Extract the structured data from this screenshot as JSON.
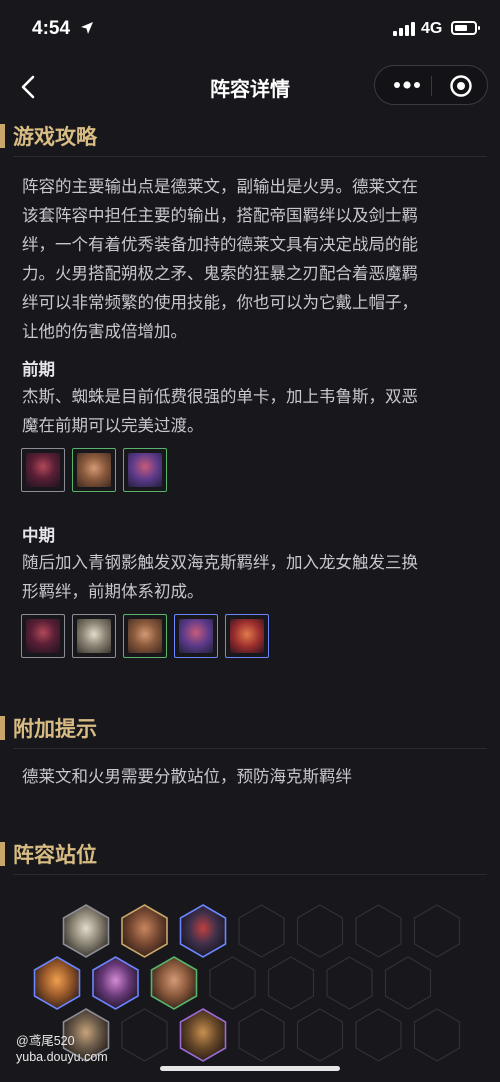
{
  "status": {
    "time": "4:54",
    "network": "4G"
  },
  "nav": {
    "title": "阵容详情"
  },
  "strategy": {
    "heading": "游戏攻略",
    "lines": [
      "阵容的主要输出点是德莱文，副输出是火男。德莱文在",
      "该套阵容中担任主要的输出，搭配帝国羁绊以及剑士羁",
      "绊，一个有着优秀装备加持的德莱文具有决定战局的能",
      "力。火男搭配朔极之矛、鬼索的狂暴之刃配合着恶魔羁",
      "绊可以非常频繁的使用技能，你也可以为它戴上帽子，",
      "让他的伤害成倍增加。"
    ],
    "early": {
      "label": "前期",
      "lines": [
        "杰斯、蜘蛛是目前低费很强的单卡，加上韦鲁斯，双恶",
        "魔在前期可以完美过渡。"
      ]
    },
    "mid": {
      "label": "中期",
      "lines": [
        "随后加入青钢影触发双海克斯羁绊，加入龙女触发三换",
        "形羁绊，前期体系初成。"
      ]
    }
  },
  "tips": {
    "heading": "附加提示",
    "text": "德莱文和火男需要分散站位，预防海克斯羁绊"
  },
  "positions": {
    "heading": "阵容站位"
  },
  "watermark": {
    "line1": "@鸢尾520",
    "line2": "yuba.douyu.com"
  },
  "colors": {
    "accent": "#c9a76a",
    "heading": "#d8bc83",
    "bg": "#17171c"
  },
  "icons": {
    "back": "chevron-left-icon",
    "more": "more-dots-icon",
    "close": "target-close-icon"
  }
}
